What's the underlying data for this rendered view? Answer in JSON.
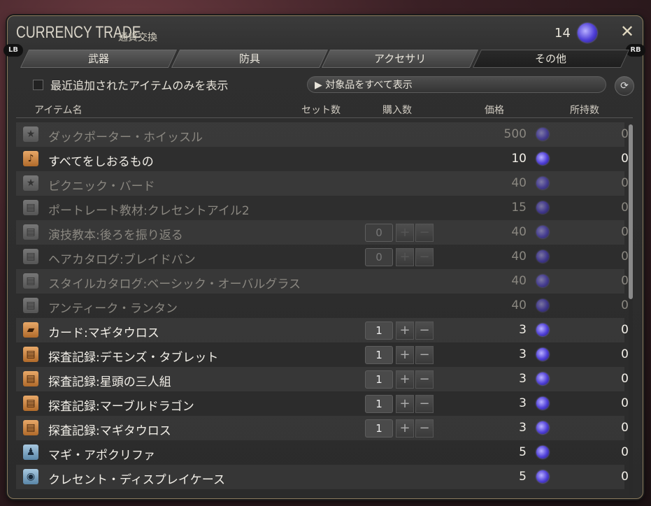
{
  "window": {
    "title": "CURRENCY TRADE",
    "subtitle": "通貨交換",
    "currency_count": "14",
    "lb_badge": "LB",
    "rb_badge": "RB"
  },
  "tabs": [
    {
      "label": "武器"
    },
    {
      "label": "防具"
    },
    {
      "label": "アクセサリ"
    },
    {
      "label": "その他",
      "active": true
    }
  ],
  "filter": {
    "recent_only_label": "最近追加されたアイテムのみを表示",
    "show_all_label": "対象品をすべて表示"
  },
  "columns": {
    "item_name": "アイテム名",
    "set_count": "セット数",
    "purchase_qty": "購入数",
    "price": "価格",
    "owned": "所持数"
  },
  "items": [
    {
      "name": "ダックポーター・ホイッスル",
      "price": "500",
      "owned": "0",
      "icon": "star-icon",
      "enabled": false,
      "qty": null
    },
    {
      "name": "すべてをしおるもの",
      "price": "10",
      "owned": "0",
      "icon": "music-note-icon",
      "enabled": true,
      "qty": null
    },
    {
      "name": "ピクニック・バード",
      "price": "40",
      "owned": "0",
      "icon": "star-icon",
      "enabled": false,
      "qty": null
    },
    {
      "name": "ポートレート教材:クレセントアイル2",
      "price": "15",
      "owned": "0",
      "icon": "book-icon",
      "enabled": false,
      "qty": null
    },
    {
      "name": "演技教本:後ろを振り返る",
      "price": "40",
      "owned": "0",
      "icon": "book-icon",
      "enabled": false,
      "qty": "0"
    },
    {
      "name": "ヘアカタログ:ブレイドバン",
      "price": "40",
      "owned": "0",
      "icon": "book-icon",
      "enabled": false,
      "qty": "0"
    },
    {
      "name": "スタイルカタログ:ベーシック・オーバルグラス",
      "price": "40",
      "owned": "0",
      "icon": "book-icon",
      "enabled": false,
      "qty": null
    },
    {
      "name": "アンティーク・ランタン",
      "price": "40",
      "owned": "0",
      "icon": "book-icon",
      "enabled": false,
      "qty": null
    },
    {
      "name": "カード:マギタウロス",
      "price": "3",
      "owned": "0",
      "icon": "card-icon",
      "enabled": true,
      "qty": "1"
    },
    {
      "name": "探査記録:デモンズ・タブレット",
      "price": "3",
      "owned": "0",
      "icon": "book-icon",
      "enabled": true,
      "qty": "1"
    },
    {
      "name": "探査記録:星頭の三人組",
      "price": "3",
      "owned": "0",
      "icon": "book-icon",
      "enabled": true,
      "qty": "1"
    },
    {
      "name": "探査記録:マーブルドラゴン",
      "price": "3",
      "owned": "0",
      "icon": "book-icon",
      "enabled": true,
      "qty": "1"
    },
    {
      "name": "探査記録:マギタウロス",
      "price": "3",
      "owned": "0",
      "icon": "book-icon",
      "enabled": true,
      "qty": "1"
    },
    {
      "name": "マギ・アポクリファ",
      "price": "5",
      "owned": "0",
      "icon": "figure-icon",
      "enabled": true,
      "qty": null
    },
    {
      "name": "クレセント・ディスプレイケース",
      "price": "5",
      "owned": "0",
      "icon": "case-icon",
      "enabled": true,
      "qty": null
    }
  ]
}
